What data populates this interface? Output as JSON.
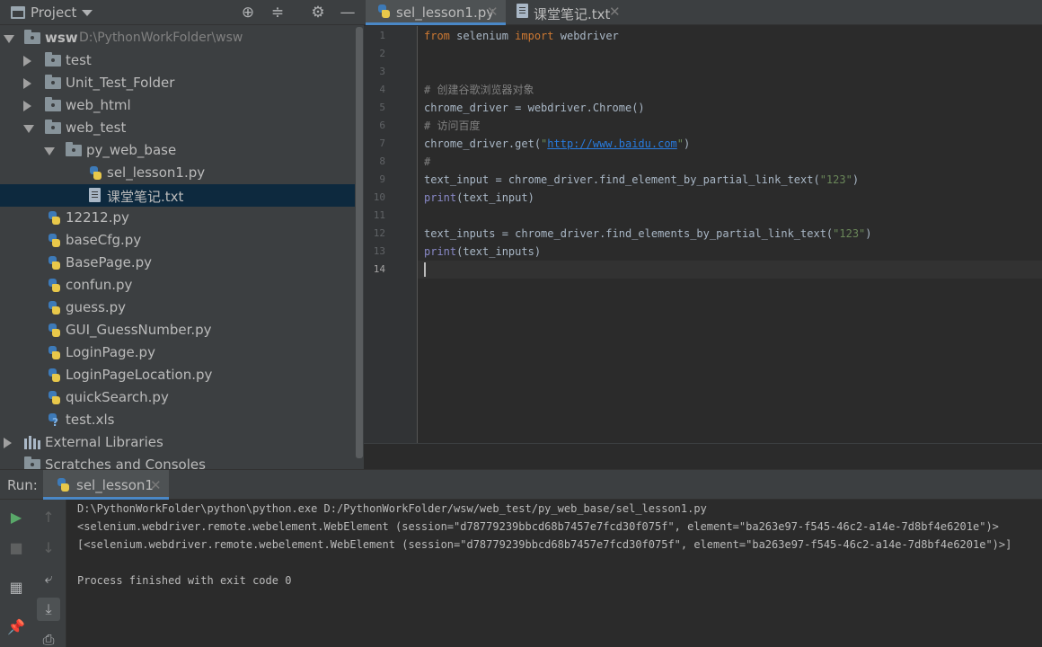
{
  "project": {
    "title": "Project",
    "root_name": "wsw",
    "root_path": "D:\\PythonWorkFolder\\wsw",
    "items": [
      {
        "label": "test"
      },
      {
        "label": "Unit_Test_Folder"
      },
      {
        "label": "web_html"
      },
      {
        "label": "web_test"
      },
      {
        "label": "py_web_base"
      },
      {
        "label": "sel_lesson1.py"
      },
      {
        "label": "课堂笔记.txt"
      },
      {
        "label": "12212.py"
      },
      {
        "label": "baseCfg.py"
      },
      {
        "label": "BasePage.py"
      },
      {
        "label": "confun.py"
      },
      {
        "label": "guess.py"
      },
      {
        "label": "GUI_GuessNumber.py"
      },
      {
        "label": "LoginPage.py"
      },
      {
        "label": "LoginPageLocation.py"
      },
      {
        "label": "quickSearch.py"
      },
      {
        "label": "test.xls"
      },
      {
        "label": "External Libraries"
      },
      {
        "label": "Scratches and Consoles"
      }
    ]
  },
  "editor": {
    "tabs": [
      {
        "label": "sel_lesson1.py"
      },
      {
        "label": "课堂笔记.txt"
      }
    ],
    "line_numbers": [
      "1",
      "2",
      "3",
      "4",
      "5",
      "6",
      "7",
      "8",
      "9",
      "10",
      "11",
      "12",
      "13",
      "14"
    ],
    "code": {
      "l1_kw1": "from",
      "l1_t1": " selenium ",
      "l1_kw2": "import",
      "l1_t2": " webdriver",
      "l4_cm": "# 创建谷歌浏览器对象",
      "l5": "chrome_driver = webdriver.Chrome()",
      "l6_cm": "# 访问百度",
      "l7_t1": "chrome_driver.get(",
      "l7_q1": "\"",
      "l7_url": "http://www.baidu.com",
      "l7_q2": "\"",
      "l7_t2": ")",
      "l8_cm": "#",
      "l9_t1": "text_input = chrome_driver.find_element_by_partial_link_text(",
      "l9_str": "\"123\"",
      "l9_t2": ")",
      "l10_fn": "print",
      "l10_t": "(text_input)",
      "l12_t1": "text_inputs = chrome_driver.find_elements_by_partial_link_text(",
      "l12_str": "\"123\"",
      "l12_t2": ")",
      "l13_fn": "print",
      "l13_t": "(text_inputs)"
    }
  },
  "run": {
    "title": "Run:",
    "tab_label": "sel_lesson1",
    "console": [
      "D:\\PythonWorkFolder\\python\\python.exe D:/PythonWorkFolder/wsw/web_test/py_web_base/sel_lesson1.py",
      "<selenium.webdriver.remote.webelement.WebElement (session=\"d78779239bbcd68b7457e7fcd30f075f\", element=\"ba263e97-f545-46c2-a14e-7d8bf4e6201e\")>",
      "[<selenium.webdriver.remote.webelement.WebElement (session=\"d78779239bbcd68b7457e7fcd30f075f\", element=\"ba263e97-f545-46c2-a14e-7d8bf4e6201e\")>]",
      "",
      "Process finished with exit code 0"
    ]
  }
}
